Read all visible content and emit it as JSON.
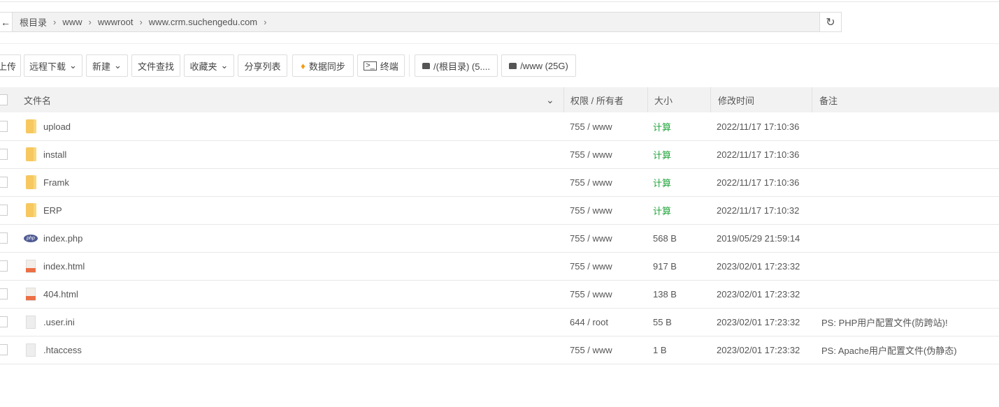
{
  "breadcrumb": [
    "根目录",
    "www",
    "wwwroot",
    "www.crm.suchengedu.com"
  ],
  "toolbar": {
    "upload": "上传",
    "remote_download": "远程下载",
    "new": "新建",
    "file_search": "文件查找",
    "favorites": "收藏夹",
    "share_list": "分享列表",
    "data_sync": "数据同步",
    "terminal": "终端",
    "disk_root": "/(根目录) (5....",
    "disk_www": "/www (25G)"
  },
  "columns": {
    "name": "文件名",
    "perm": "权限 / 所有者",
    "size": "大小",
    "mtime": "修改时间",
    "note": "备注"
  },
  "files": [
    {
      "name": "upload",
      "type": "folder",
      "perm": "755 / www",
      "size": "计算",
      "mtime": "2022/11/17 17:10:36",
      "note": ""
    },
    {
      "name": "install",
      "type": "folder",
      "perm": "755 / www",
      "size": "计算",
      "mtime": "2022/11/17 17:10:36",
      "note": ""
    },
    {
      "name": "Framk",
      "type": "folder",
      "perm": "755 / www",
      "size": "计算",
      "mtime": "2022/11/17 17:10:36",
      "note": ""
    },
    {
      "name": "ERP",
      "type": "folder",
      "perm": "755 / www",
      "size": "计算",
      "mtime": "2022/11/17 17:10:32",
      "note": ""
    },
    {
      "name": "index.php",
      "type": "php",
      "perm": "755 / www",
      "size": "568 B",
      "mtime": "2019/05/29 21:59:14",
      "note": ""
    },
    {
      "name": "index.html",
      "type": "html",
      "perm": "755 / www",
      "size": "917 B",
      "mtime": "2023/02/01 17:23:32",
      "note": ""
    },
    {
      "name": "404.html",
      "type": "html",
      "perm": "755 / www",
      "size": "138 B",
      "mtime": "2023/02/01 17:23:32",
      "note": ""
    },
    {
      "name": ".user.ini",
      "type": "file",
      "perm": "644 / root",
      "size": "55 B",
      "mtime": "2023/02/01 17:23:32",
      "note": "PS: PHP用户配置文件(防跨站)!"
    },
    {
      "name": ".htaccess",
      "type": "file",
      "perm": "755 / www",
      "size": "1 B",
      "mtime": "2023/02/01 17:23:32",
      "note": "PS: Apache用户配置文件(伪静态)"
    }
  ]
}
